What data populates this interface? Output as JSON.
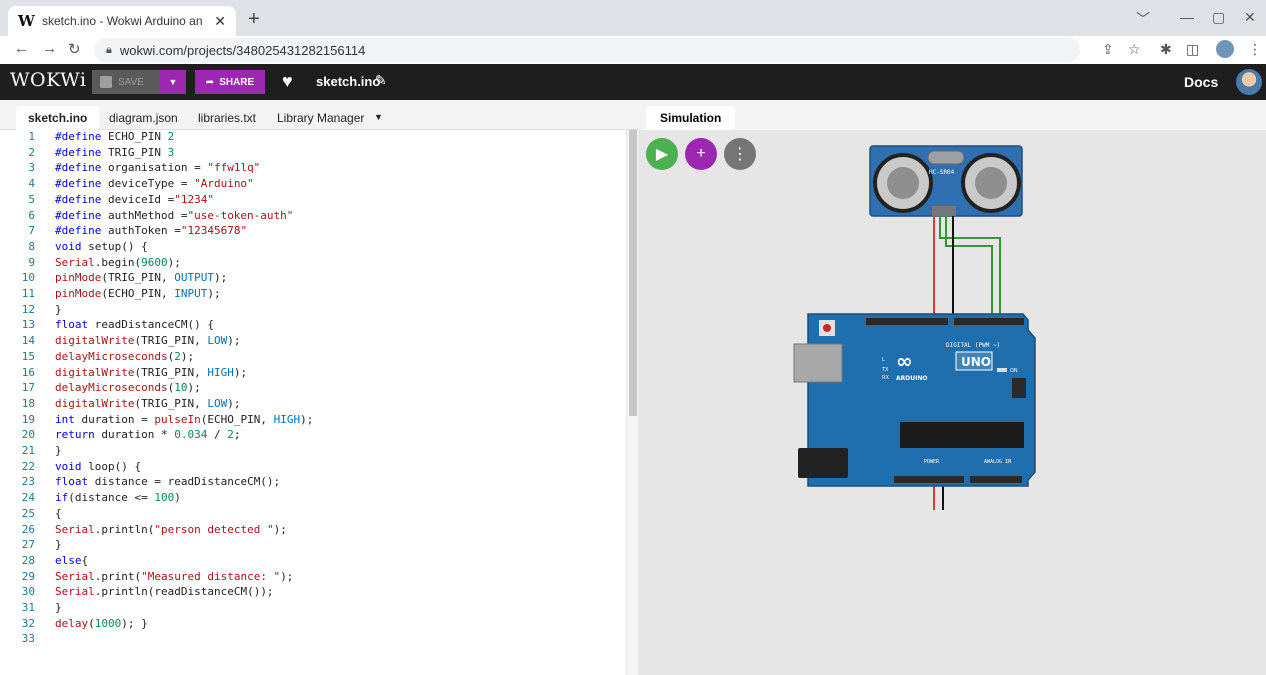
{
  "browser": {
    "tab_title": "sketch.ino - Wokwi Arduino and E",
    "favicon": "W",
    "tab_close": "✕",
    "new_tab": "+",
    "url": "wokwi.com/projects/348025431282156114"
  },
  "header": {
    "logo": "WOKWi",
    "save_label": "SAVE",
    "share_label": "SHARE",
    "project_name": "sketch.ino",
    "docs_label": "Docs"
  },
  "editor": {
    "tabs": [
      "sketch.ino",
      "diagram.json",
      "libraries.txt",
      "Library Manager"
    ],
    "active_tab": "sketch.ino",
    "lines": [
      "#define ECHO_PIN 2",
      "#define TRIG_PIN 3",
      "#define organisation = \"ffw1lq\"",
      "#define deviceType = \"Arduino\"",
      "#define deviceId =\"1234\"",
      "#define authMethod =\"use-token-auth\"",
      "#define authToken =\"12345678\"",
      "void setup() {",
      "Serial.begin(9600);",
      "pinMode(TRIG_PIN, OUTPUT);",
      "pinMode(ECHO_PIN, INPUT);",
      "}",
      "float readDistanceCM() {",
      "digitalWrite(TRIG_PIN, LOW);",
      "delayMicroseconds(2);",
      "digitalWrite(TRIG_PIN, HIGH);",
      "delayMicroseconds(10);",
      "digitalWrite(TRIG_PIN, LOW);",
      "int duration = pulseIn(ECHO_PIN, HIGH);",
      "return duration * 0.034 / 2;",
      "}",
      "void loop() {",
      "float distance = readDistanceCM();",
      "if(distance <= 100)",
      "{",
      "Serial.println(\"person detected \");",
      "}",
      "else{",
      "Serial.print(\"Measured distance: \");",
      "Serial.println(readDistanceCM());",
      "}",
      "delay(1000); }",
      ""
    ]
  },
  "simulation": {
    "tab_label": "Simulation",
    "sensor_label": "HC-SR04",
    "board_label": "UNO",
    "board_brand": "ARDUINO",
    "digital_label": "DIGITAL (PWM ~)",
    "power_label": "POWER",
    "analog_label": "ANALOG IN",
    "on_label": "ON",
    "tx_label": "TX",
    "rx_label": "RX",
    "l_label": "L",
    "wire_colors": {
      "vcc": "#e53935",
      "gnd": "#111111",
      "trig": "#2e9b2e",
      "echo": "#2e9b2e"
    },
    "run_color": "#4caf50",
    "add_color": "#9c27b0",
    "menu_color": "#757575"
  }
}
